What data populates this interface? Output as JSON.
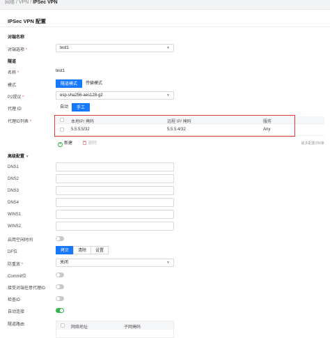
{
  "breadcrumb": {
    "items": [
      "网络",
      "VPN"
    ],
    "current": "IPSec VPN",
    "sep": "/"
  },
  "page_title": "IPSec VPN 配置",
  "peer": {
    "section": "对端名称",
    "label": "对端选项",
    "value": "test1"
  },
  "tunnel": {
    "section": "隧道",
    "name_label": "名称",
    "name_value": "test1",
    "mode_label": "模式",
    "mode_options": [
      "隧道模式",
      "传输模式"
    ],
    "p2_label": "P2提议",
    "p2_value": "esp-sha256-aes128-g2",
    "proxy_label": "代理 ID",
    "proxy_options": [
      "自动",
      "手工"
    ],
    "proxy_list_label": "代理ID列表",
    "proxy_table": {
      "headers": [
        "本地IP/ 掩码",
        "远程 IP/ 掩码",
        "服务"
      ],
      "rows": [
        {
          "local": "5.5.5.5/32",
          "remote": "5.5.5.4/32",
          "service": "Any"
        }
      ]
    },
    "add_label": "新建",
    "delete_label": "删除",
    "count_note": "最多配置256条"
  },
  "advanced": {
    "section": "高级配置",
    "dns_labels": [
      "DNS1",
      "DNS2",
      "DNS3",
      "DNS4"
    ],
    "wins_labels": [
      "WINS1",
      "WINS2"
    ],
    "idle_label": "启用空闲时间",
    "df_label": "DF位",
    "df_options": [
      "拷贝",
      "清除",
      "设置"
    ],
    "replay_label": "防重放",
    "replay_value": "关闭",
    "commit_label": "Commit位",
    "accept_label": "接受对端任意代理ID",
    "checkid_label": "检查ID",
    "autoconn_label": "自动连接",
    "route_label": "隧道路由",
    "route_table_headers": [
      "网络地址",
      "子网掩码"
    ]
  },
  "colors": {
    "primary": "#1677ff",
    "toggle_on": "#38b24a",
    "highlight_border": "#e53935"
  }
}
